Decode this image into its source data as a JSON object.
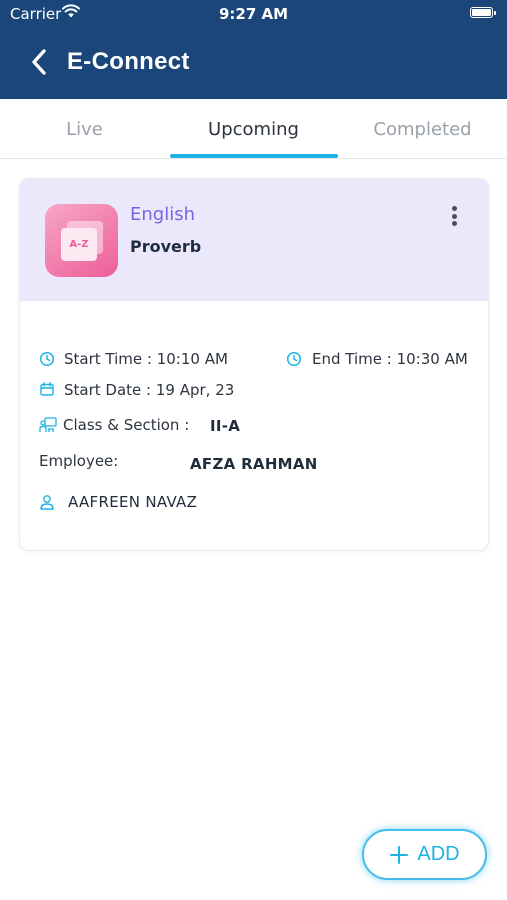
{
  "status_bar": {
    "carrier": "Carrier",
    "time": "9:27 AM"
  },
  "header": {
    "title": "E-Connect",
    "back_icon": "chevron-left-icon"
  },
  "tabs": [
    {
      "label": "Live",
      "active": false
    },
    {
      "label": "Upcoming",
      "active": true
    },
    {
      "label": "Completed",
      "active": false
    }
  ],
  "card": {
    "icon_text": "A-Z",
    "subject": "English",
    "topic": "Proverb",
    "start_time": "Start Time : 10:10 AM",
    "end_time": "End Time : 10:30 AM",
    "start_date": "Start Date : 19 Apr, 23",
    "class_section_label": "Class & Section :",
    "class_section_value": "II-A",
    "employee_label": "Employee:",
    "employee_value": "AFZA RAHMAN",
    "student": "AAFREEN NAVAZ"
  },
  "fab": {
    "label": "ADD"
  },
  "colors": {
    "header_bg": "#1a4679",
    "accent": "#1fb2e6",
    "card_head_bg": "#ebe8fb",
    "subject_text": "#7b63e0",
    "icon_pink": "#ec5e98"
  }
}
